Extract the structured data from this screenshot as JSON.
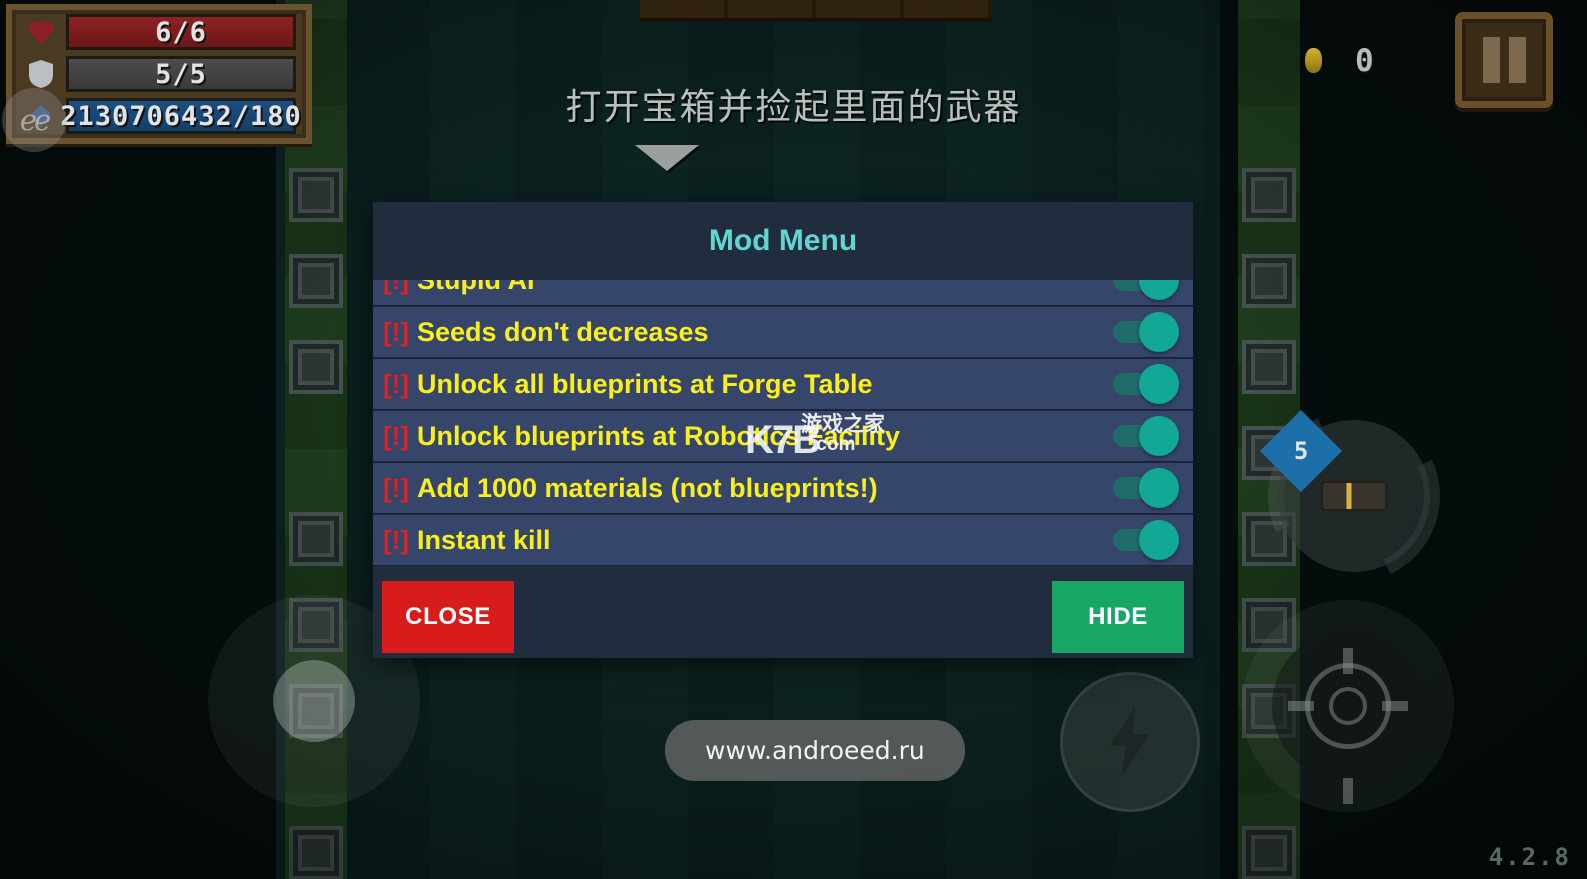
{
  "game": {
    "objective_text": "打开宝箱并捡起里面的武器",
    "version": "4.2.8",
    "hud": {
      "health": "6/6",
      "shield": "5/5",
      "experience": "2130706432/180",
      "coin_count": "0",
      "ee_watermark": "ee"
    },
    "controls": {
      "pause_label": "pause-button",
      "move_joystick_label": "move-joystick",
      "aim_joystick_label": "aim-joystick",
      "dash_label": "dash-button",
      "weapon_label": "weapon-reload-button",
      "ammo_badge": "5"
    },
    "toast": {
      "text": "www.androeed.ru"
    },
    "watermark": {
      "brand": "K7B",
      "chinese": "游戏之家",
      "domain": ".com"
    }
  },
  "dialog": {
    "title": "Mod Menu",
    "accent_color": "#5fd6cf",
    "background_color": "#212c3f",
    "row_color": "#36456a",
    "label_color": "#f8ef1c",
    "marker_color": "#e02020",
    "switch_on_color": "#12a896",
    "items": [
      {
        "marker": "[!]",
        "label": "Stupid AI",
        "enabled": "on"
      },
      {
        "marker": "[!]",
        "label": "Seeds don't decreases",
        "enabled": "on"
      },
      {
        "marker": "[!]",
        "label": "Unlock all blueprints at Forge Table",
        "enabled": "on"
      },
      {
        "marker": "[!]",
        "label": "Unlock blueprints at Robotics Facility",
        "enabled": "on"
      },
      {
        "marker": "[!]",
        "label": "Add 1000 materials (not blueprints!)",
        "enabled": "on"
      },
      {
        "marker": "[!]",
        "label": "Instant kill",
        "enabled": "on"
      }
    ],
    "actions": {
      "close_label": "CLOSE",
      "close_color": "#d81b1b",
      "hide_label": "HIDE",
      "hide_color": "#16a765"
    }
  }
}
